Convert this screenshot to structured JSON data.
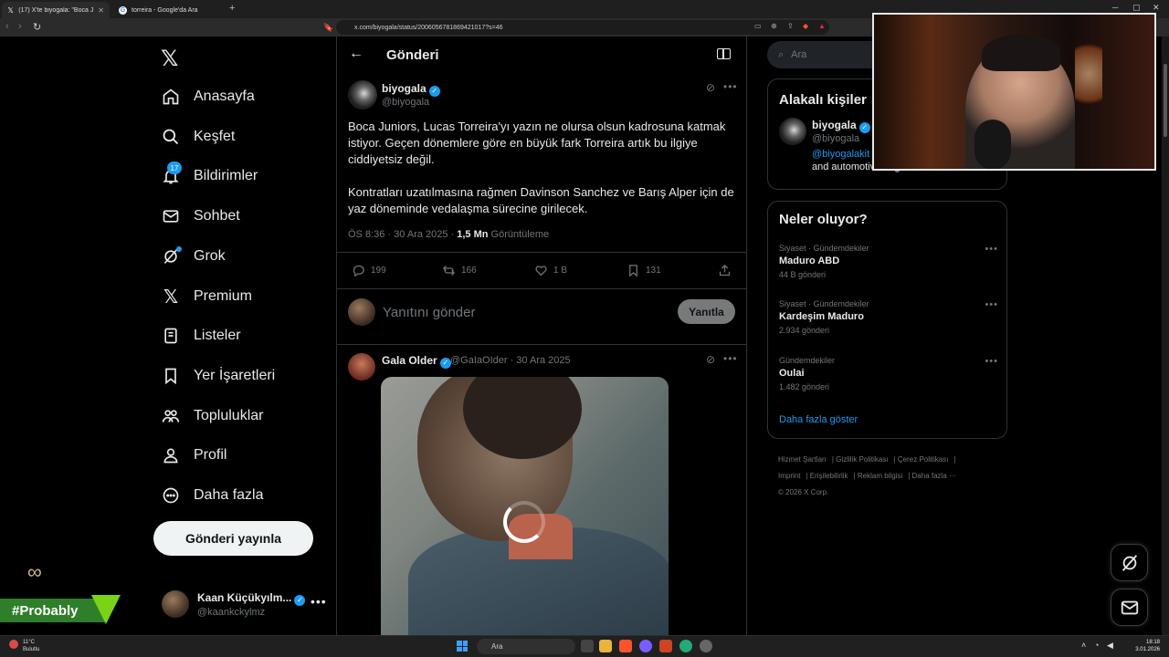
{
  "browser": {
    "tabs": [
      {
        "title": "(17) X'te biyogala: \"Boca Juniors",
        "favicon": "X",
        "active": true
      },
      {
        "title": "torreira - Google'da Ara",
        "favicon": "G",
        "active": false
      }
    ],
    "url": "x.com/biyogala/status/2006056781869421017?s=46"
  },
  "sidebar": {
    "nav": [
      {
        "label": "Anasayfa",
        "icon": "home-icon"
      },
      {
        "label": "Keşfet",
        "icon": "search-icon"
      },
      {
        "label": "Bildirimler",
        "icon": "bell-icon",
        "badge": "17"
      },
      {
        "label": "Sohbet",
        "icon": "mail-icon"
      },
      {
        "label": "Grok",
        "icon": "grok-icon"
      },
      {
        "label": "Premium",
        "icon": "x-premium-icon"
      },
      {
        "label": "Listeler",
        "icon": "list-icon"
      },
      {
        "label": "Yer İşaretleri",
        "icon": "bookmark-icon"
      },
      {
        "label": "Topluluklar",
        "icon": "communities-icon"
      },
      {
        "label": "Profil",
        "icon": "profile-icon"
      },
      {
        "label": "Daha fazla",
        "icon": "more-circle-icon"
      }
    ],
    "post_button": "Gönderi yayınla",
    "account": {
      "name": "Kaan Küçükyılm...",
      "handle": "@kaankckylmz"
    }
  },
  "overlay": {
    "tag": "#Probably"
  },
  "main": {
    "header_title": "Gönderi",
    "tweet": {
      "name": "biyogala",
      "handle": "@biyogala",
      "paragraphs": [
        "Boca Juniors, Lucas Torreira'yı yazın ne olursa olsun kadrosuna katmak istiyor. Geçen dönemlere göre en büyük fark Torreira artık bu ilgiye ciddiyetsiz değil.",
        "Kontratları uzatılmasına rağmen Davinson Sanchez ve Barış Alper için de yaz döneminde vedalaşma sürecine girilecek."
      ],
      "time": "ÖS 8:36 · 30 Ara 2025 · ",
      "views_value": "1,5 Mn",
      "views_label": " Görüntüleme",
      "replies": "199",
      "reposts": "166",
      "likes": "1 B",
      "bookmarks": "131"
    },
    "reply_placeholder": "Yanıtını gönder",
    "reply_button": "Yanıtla",
    "reply_post": {
      "name": "Gala Older",
      "handle": "@GaIaOIder · 30 Ara 2025"
    }
  },
  "right": {
    "search_placeholder": "Ara",
    "related": {
      "title": "Alakalı kişiler",
      "name": "biyogala",
      "handle": "@biyogala",
      "bio_link": "@biyogalakit",
      "bio_text": "and automotive engineer"
    },
    "trends": {
      "title": "Neler oluyor?",
      "items": [
        {
          "context": "Siyaset · Gündemdekiler",
          "title": "Maduro ABD",
          "count": "44 B gönderi"
        },
        {
          "context": "Siyaset · Gündemdekiler",
          "title": "Kardeşim Maduro",
          "count": "2.934 gönderi"
        },
        {
          "context": "Gündemdekiler",
          "title": "Oulai",
          "count": "1.482 gönderi"
        }
      ],
      "show_more": "Daha fazla göster"
    },
    "footer": {
      "links": [
        "Hizmet Şartları",
        "Gizlilik Politikası",
        "Çerez Politikası",
        "Imprint",
        "Erişilebilirlik",
        "Reklam bilgisi",
        "Daha fazla ···"
      ],
      "copyright": "© 2026 X Corp."
    }
  },
  "taskbar": {
    "weather_temp": "11°C",
    "weather_text": "Bulutlu",
    "search": "Ara",
    "time": "18:18",
    "date": "3.01.2026"
  }
}
